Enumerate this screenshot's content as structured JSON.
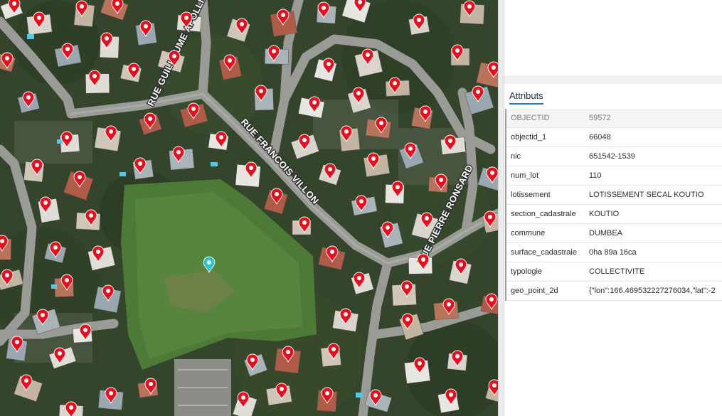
{
  "map": {
    "streets": [
      {
        "id": "guillaume",
        "label": "RUE GUILLAUME APOLLINAIRE"
      },
      {
        "id": "villon",
        "label": "RUE FRANCOIS VILLON"
      },
      {
        "id": "ronsard",
        "label": "RUE PIERRE RONSARD"
      }
    ],
    "marker_icon": "map-pin-icon",
    "marker_color": "#e3101f",
    "selected_icon": "selected-point-icon",
    "selected_color": "#2fc4c8"
  },
  "panel": {
    "title": "Attributs",
    "rows": [
      {
        "key": "OBJECTID",
        "value": "59572"
      },
      {
        "key": "objectid_1",
        "value": "66048"
      },
      {
        "key": "nic",
        "value": "651542-1539"
      },
      {
        "key": "num_lot",
        "value": "110"
      },
      {
        "key": "lotissement",
        "value": "LOTISSEMENT SECAL KOUTIO"
      },
      {
        "key": "section_cadastrale",
        "value": "KOUTIO"
      },
      {
        "key": "commune",
        "value": "DUMBEA"
      },
      {
        "key": "surface_cadastrale",
        "value": "0ha 89a 16ca"
      },
      {
        "key": "typologie",
        "value": "COLLECTIVITE"
      },
      {
        "key": "geo_point_2d",
        "value": "{\"lon\":166.469532227276034,\"lat\":-2"
      }
    ]
  }
}
